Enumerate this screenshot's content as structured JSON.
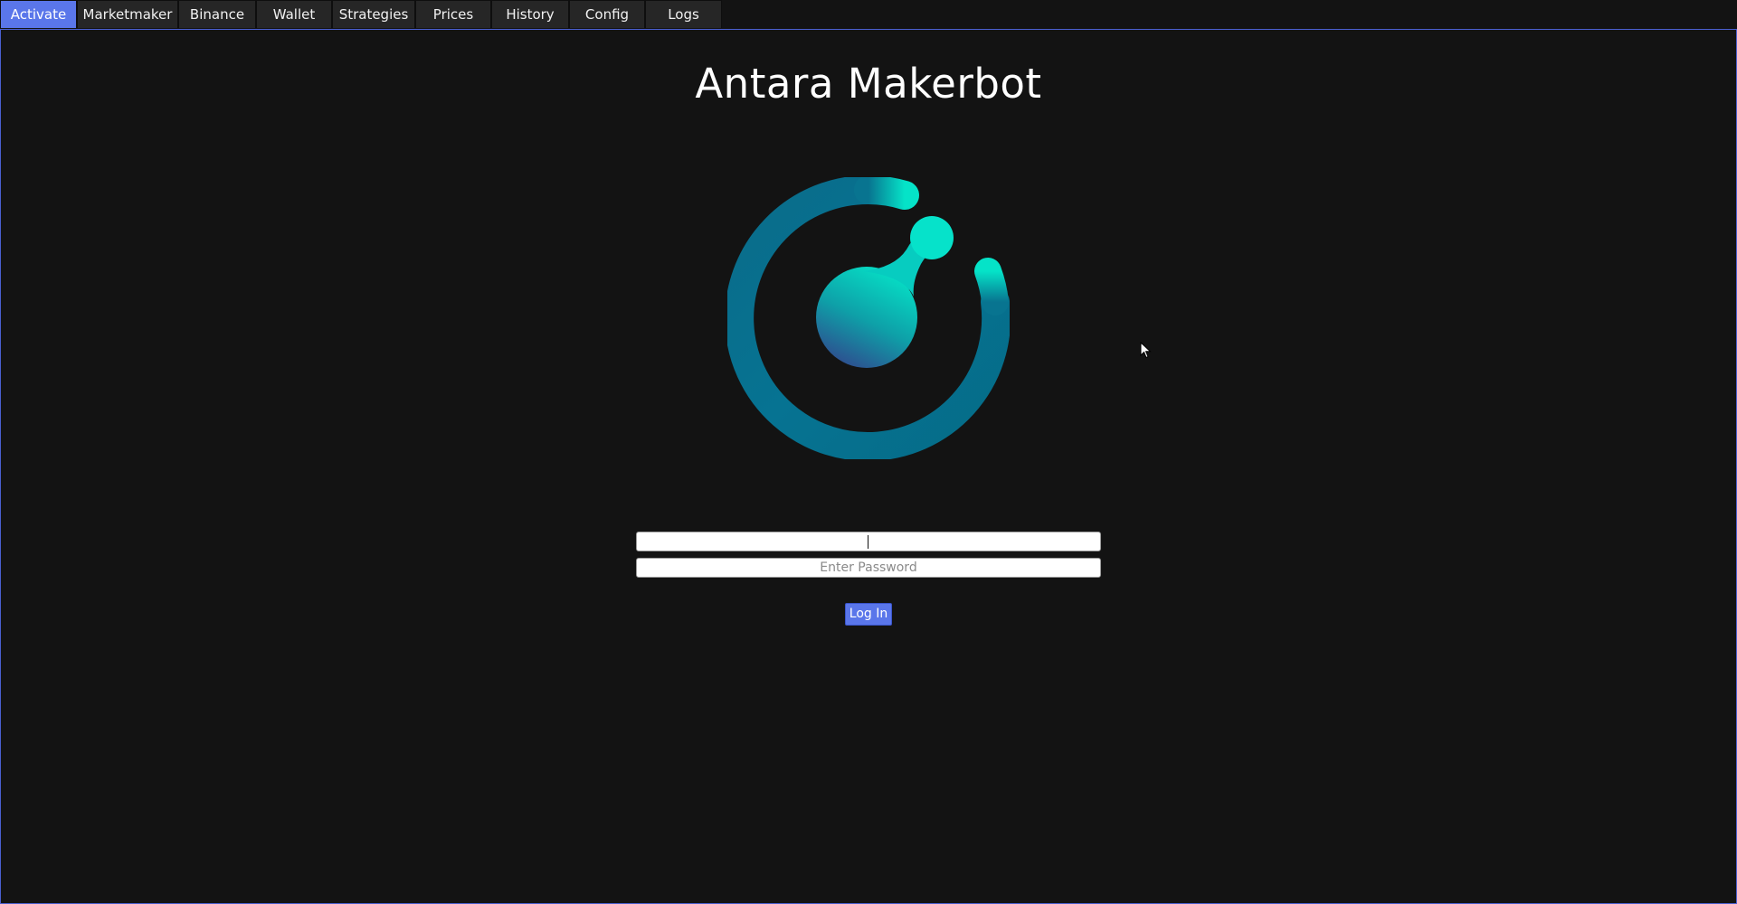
{
  "tabs": [
    {
      "label": "Activate",
      "active": true
    },
    {
      "label": "Marketmaker",
      "active": false
    },
    {
      "label": "Binance",
      "active": false
    },
    {
      "label": "Wallet",
      "active": false
    },
    {
      "label": "Strategies",
      "active": false
    },
    {
      "label": "Prices",
      "active": false
    },
    {
      "label": "History",
      "active": false
    },
    {
      "label": "Config",
      "active": false
    },
    {
      "label": "Logs",
      "active": false
    }
  ],
  "main": {
    "title": "Antara Makerbot",
    "logo_icon": "komodo-logo-icon",
    "username_value": "",
    "password_placeholder": "Enter Password",
    "login_label": "Log In"
  },
  "colors": {
    "background": "#131313",
    "accent": "#5a76ea",
    "tab_inactive": "#262626",
    "logo_teal": "#05e6c9",
    "logo_ring": "#07708f"
  }
}
